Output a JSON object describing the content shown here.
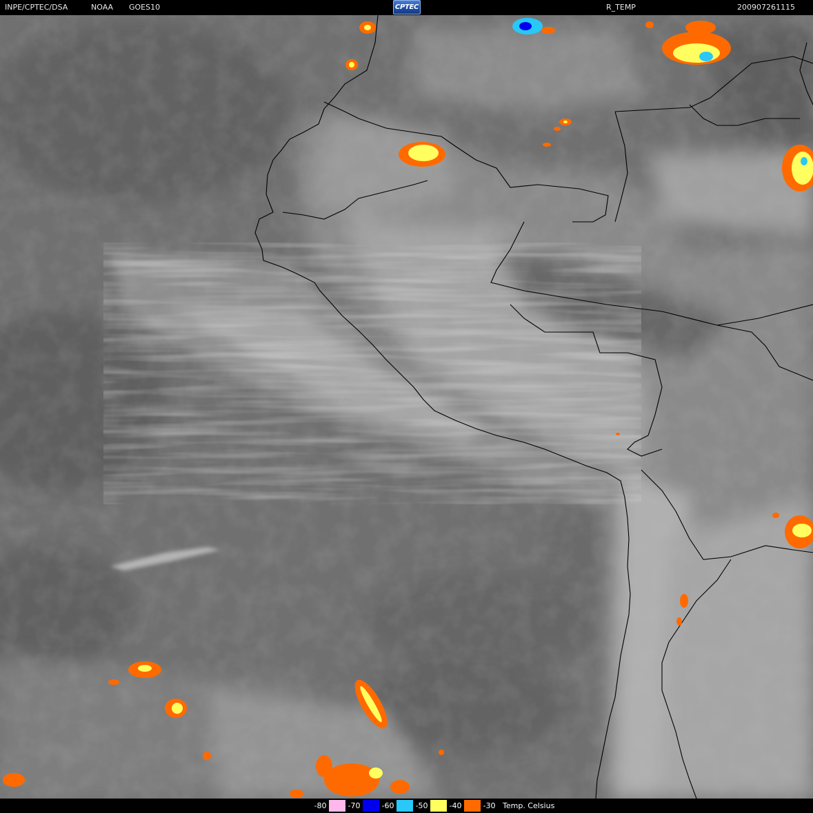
{
  "header": {
    "agency": "INPE/CPTEC/DSA",
    "source": "NOAA",
    "satellite": "GOES10",
    "logo_text": "CPTEC",
    "product": "R_TEMP",
    "timestamp": "200907261115"
  },
  "map": {
    "base_color": "#707070",
    "border_color": "#000000"
  },
  "legend": {
    "items": [
      {
        "label": "-80",
        "color": "#ffb8ec"
      },
      {
        "label": "-70",
        "color": "#0000ee"
      },
      {
        "label": "-60",
        "color": "#28c8f8"
      },
      {
        "label": "-50",
        "color": "#ffff60"
      },
      {
        "label": "-40",
        "color": "#ff6a00"
      },
      {
        "label": "-30",
        "color": ""
      }
    ],
    "title": "Temp. Celsius"
  }
}
